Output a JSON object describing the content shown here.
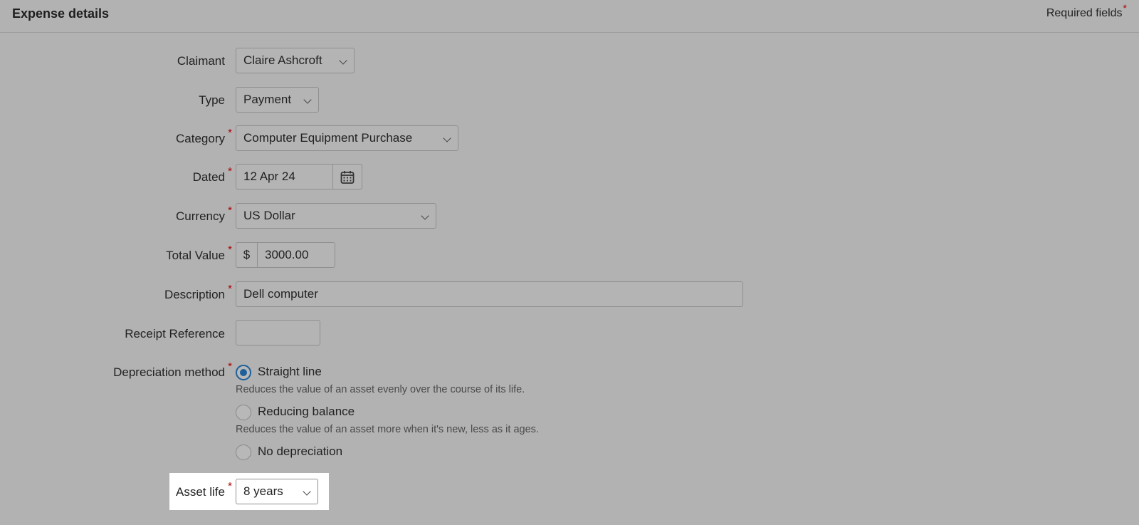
{
  "header": {
    "title": "Expense details",
    "required_note": "Required fields",
    "required_star": "*"
  },
  "form": {
    "claimant": {
      "label": "Claimant",
      "value": "Claire Ashcroft"
    },
    "type": {
      "label": "Type",
      "value": "Payment"
    },
    "category": {
      "label": "Category",
      "value": "Computer Equipment Purchase"
    },
    "dated": {
      "label": "Dated",
      "value": "12 Apr 24",
      "icon": "calendar-icon"
    },
    "currency": {
      "label": "Currency",
      "value": "US Dollar"
    },
    "total_value": {
      "label": "Total Value",
      "prefix": "$",
      "value": "3000.00"
    },
    "description": {
      "label": "Description",
      "value": "Dell computer"
    },
    "receipt_reference": {
      "label": "Receipt Reference",
      "value": ""
    },
    "depreciation": {
      "label": "Depreciation method",
      "options": [
        {
          "label": "Straight line",
          "hint": "Reduces the value of an asset evenly over the course of its life.",
          "selected": true
        },
        {
          "label": "Reducing balance",
          "hint": "Reduces the value of an asset more when it's new, less as it ages.",
          "selected": false
        },
        {
          "label": "No depreciation",
          "hint": "",
          "selected": false
        }
      ]
    },
    "asset_life": {
      "label": "Asset life",
      "value": "8 years"
    }
  },
  "colors": {
    "overlay": "#b2b2b2",
    "required_star": "#b00000",
    "radio_selected": "#1f5f9a",
    "highlight": "#ffffff"
  }
}
